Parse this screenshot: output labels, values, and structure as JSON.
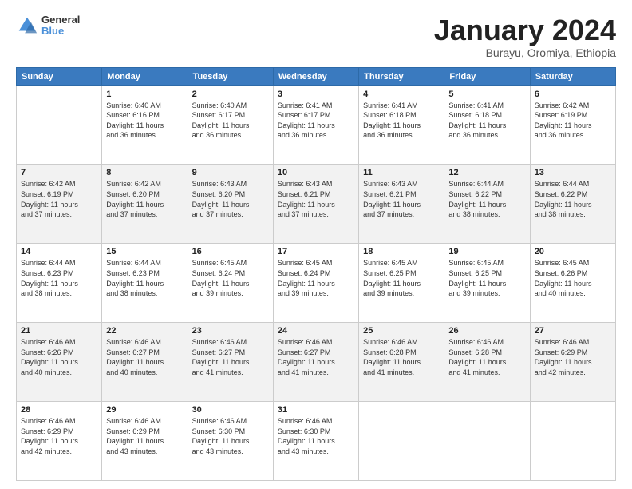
{
  "logo": {
    "line1": "General",
    "line2": "Blue"
  },
  "header": {
    "month": "January 2024",
    "location": "Burayu, Oromiya, Ethiopia"
  },
  "weekdays": [
    "Sunday",
    "Monday",
    "Tuesday",
    "Wednesday",
    "Thursday",
    "Friday",
    "Saturday"
  ],
  "weeks": [
    [
      {
        "day": "",
        "info": ""
      },
      {
        "day": "1",
        "info": "Sunrise: 6:40 AM\nSunset: 6:16 PM\nDaylight: 11 hours\nand 36 minutes."
      },
      {
        "day": "2",
        "info": "Sunrise: 6:40 AM\nSunset: 6:17 PM\nDaylight: 11 hours\nand 36 minutes."
      },
      {
        "day": "3",
        "info": "Sunrise: 6:41 AM\nSunset: 6:17 PM\nDaylight: 11 hours\nand 36 minutes."
      },
      {
        "day": "4",
        "info": "Sunrise: 6:41 AM\nSunset: 6:18 PM\nDaylight: 11 hours\nand 36 minutes."
      },
      {
        "day": "5",
        "info": "Sunrise: 6:41 AM\nSunset: 6:18 PM\nDaylight: 11 hours\nand 36 minutes."
      },
      {
        "day": "6",
        "info": "Sunrise: 6:42 AM\nSunset: 6:19 PM\nDaylight: 11 hours\nand 36 minutes."
      }
    ],
    [
      {
        "day": "7",
        "info": "Sunrise: 6:42 AM\nSunset: 6:19 PM\nDaylight: 11 hours\nand 37 minutes."
      },
      {
        "day": "8",
        "info": "Sunrise: 6:42 AM\nSunset: 6:20 PM\nDaylight: 11 hours\nand 37 minutes."
      },
      {
        "day": "9",
        "info": "Sunrise: 6:43 AM\nSunset: 6:20 PM\nDaylight: 11 hours\nand 37 minutes."
      },
      {
        "day": "10",
        "info": "Sunrise: 6:43 AM\nSunset: 6:21 PM\nDaylight: 11 hours\nand 37 minutes."
      },
      {
        "day": "11",
        "info": "Sunrise: 6:43 AM\nSunset: 6:21 PM\nDaylight: 11 hours\nand 37 minutes."
      },
      {
        "day": "12",
        "info": "Sunrise: 6:44 AM\nSunset: 6:22 PM\nDaylight: 11 hours\nand 38 minutes."
      },
      {
        "day": "13",
        "info": "Sunrise: 6:44 AM\nSunset: 6:22 PM\nDaylight: 11 hours\nand 38 minutes."
      }
    ],
    [
      {
        "day": "14",
        "info": "Sunrise: 6:44 AM\nSunset: 6:23 PM\nDaylight: 11 hours\nand 38 minutes."
      },
      {
        "day": "15",
        "info": "Sunrise: 6:44 AM\nSunset: 6:23 PM\nDaylight: 11 hours\nand 38 minutes."
      },
      {
        "day": "16",
        "info": "Sunrise: 6:45 AM\nSunset: 6:24 PM\nDaylight: 11 hours\nand 39 minutes."
      },
      {
        "day": "17",
        "info": "Sunrise: 6:45 AM\nSunset: 6:24 PM\nDaylight: 11 hours\nand 39 minutes."
      },
      {
        "day": "18",
        "info": "Sunrise: 6:45 AM\nSunset: 6:25 PM\nDaylight: 11 hours\nand 39 minutes."
      },
      {
        "day": "19",
        "info": "Sunrise: 6:45 AM\nSunset: 6:25 PM\nDaylight: 11 hours\nand 39 minutes."
      },
      {
        "day": "20",
        "info": "Sunrise: 6:45 AM\nSunset: 6:26 PM\nDaylight: 11 hours\nand 40 minutes."
      }
    ],
    [
      {
        "day": "21",
        "info": "Sunrise: 6:46 AM\nSunset: 6:26 PM\nDaylight: 11 hours\nand 40 minutes."
      },
      {
        "day": "22",
        "info": "Sunrise: 6:46 AM\nSunset: 6:27 PM\nDaylight: 11 hours\nand 40 minutes."
      },
      {
        "day": "23",
        "info": "Sunrise: 6:46 AM\nSunset: 6:27 PM\nDaylight: 11 hours\nand 41 minutes."
      },
      {
        "day": "24",
        "info": "Sunrise: 6:46 AM\nSunset: 6:27 PM\nDaylight: 11 hours\nand 41 minutes."
      },
      {
        "day": "25",
        "info": "Sunrise: 6:46 AM\nSunset: 6:28 PM\nDaylight: 11 hours\nand 41 minutes."
      },
      {
        "day": "26",
        "info": "Sunrise: 6:46 AM\nSunset: 6:28 PM\nDaylight: 11 hours\nand 41 minutes."
      },
      {
        "day": "27",
        "info": "Sunrise: 6:46 AM\nSunset: 6:29 PM\nDaylight: 11 hours\nand 42 minutes."
      }
    ],
    [
      {
        "day": "28",
        "info": "Sunrise: 6:46 AM\nSunset: 6:29 PM\nDaylight: 11 hours\nand 42 minutes."
      },
      {
        "day": "29",
        "info": "Sunrise: 6:46 AM\nSunset: 6:29 PM\nDaylight: 11 hours\nand 43 minutes."
      },
      {
        "day": "30",
        "info": "Sunrise: 6:46 AM\nSunset: 6:30 PM\nDaylight: 11 hours\nand 43 minutes."
      },
      {
        "day": "31",
        "info": "Sunrise: 6:46 AM\nSunset: 6:30 PM\nDaylight: 11 hours\nand 43 minutes."
      },
      {
        "day": "",
        "info": ""
      },
      {
        "day": "",
        "info": ""
      },
      {
        "day": "",
        "info": ""
      }
    ]
  ]
}
